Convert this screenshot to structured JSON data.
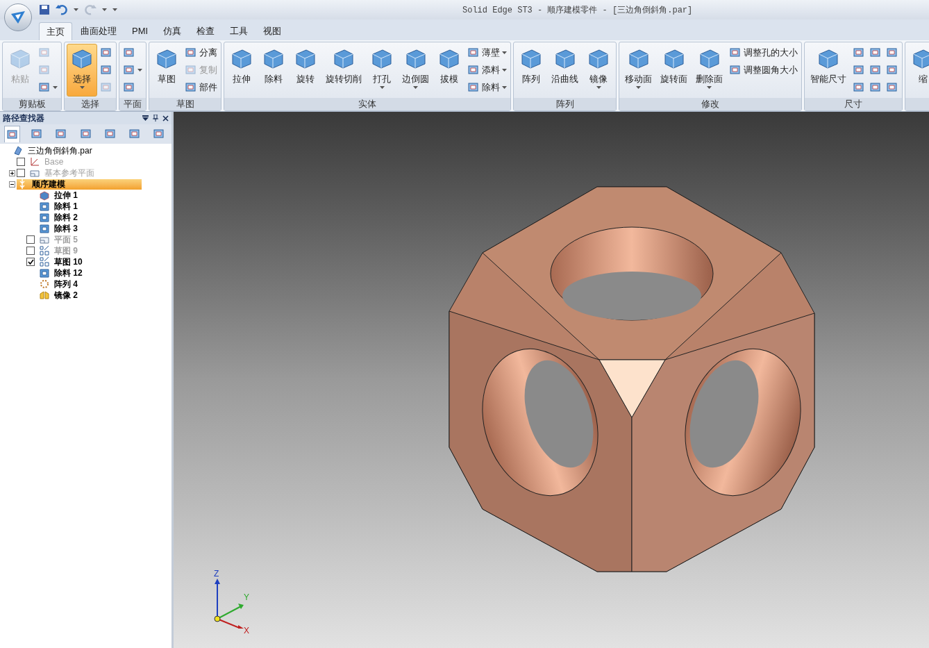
{
  "window": {
    "title": "Solid Edge ST3 - 顺序建模零件 - [三边角倒斜角.par]"
  },
  "tabs": [
    {
      "label": "主页",
      "selected": true
    },
    {
      "label": "曲面处理",
      "selected": false
    },
    {
      "label": "PMI",
      "selected": false
    },
    {
      "label": "仿真",
      "selected": false
    },
    {
      "label": "检查",
      "selected": false
    },
    {
      "label": "工具",
      "selected": false
    },
    {
      "label": "视图",
      "selected": false
    }
  ],
  "ribbon": [
    {
      "label": "剪贴板",
      "items": [
        {
          "kind": "large",
          "label": "粘贴",
          "disabled": true,
          "dropdown": false,
          "selected": false
        },
        {
          "kind": "icon",
          "disabled": true,
          "dropdown": false
        },
        {
          "kind": "icon",
          "disabled": true,
          "dropdown": false
        },
        {
          "kind": "icon",
          "disabled": false,
          "dropdown": true
        }
      ]
    },
    {
      "label": "选择",
      "items": [
        {
          "kind": "large",
          "label": "选择",
          "disabled": false,
          "dropdown": true,
          "selected": true
        },
        {
          "kind": "icon",
          "disabled": false,
          "dropdown": false
        },
        {
          "kind": "icon",
          "disabled": false,
          "dropdown": false
        },
        {
          "kind": "icon",
          "disabled": true,
          "dropdown": false
        }
      ]
    },
    {
      "label": "平面",
      "items": [
        {
          "kind": "icon",
          "disabled": false,
          "dropdown": false
        },
        {
          "kind": "icon",
          "disabled": false,
          "dropdown": true
        },
        {
          "kind": "icon",
          "disabled": false,
          "dropdown": false
        }
      ]
    },
    {
      "label": "草图",
      "items": [
        {
          "kind": "large",
          "label": "草图",
          "disabled": false,
          "dropdown": false,
          "selected": false
        },
        {
          "kind": "small",
          "label": "分离",
          "disabled": false,
          "dropdown": false
        },
        {
          "kind": "small",
          "label": "复制",
          "disabled": true,
          "dropdown": false
        },
        {
          "kind": "small",
          "label": "部件",
          "disabled": false,
          "dropdown": false
        }
      ]
    },
    {
      "label": "实体",
      "items": [
        {
          "kind": "large",
          "label": "拉伸",
          "disabled": false,
          "dropdown": false,
          "selected": false
        },
        {
          "kind": "large",
          "label": "除料",
          "disabled": false,
          "dropdown": false,
          "selected": false
        },
        {
          "kind": "large",
          "label": "旋转",
          "disabled": false,
          "dropdown": false,
          "selected": false
        },
        {
          "kind": "large",
          "label": "旋转切削",
          "disabled": false,
          "dropdown": false,
          "selected": false
        },
        {
          "kind": "large",
          "label": "打孔",
          "disabled": false,
          "dropdown": true,
          "selected": false
        },
        {
          "kind": "large",
          "label": "边倒圆",
          "disabled": false,
          "dropdown": true,
          "selected": false
        },
        {
          "kind": "large",
          "label": "拔模",
          "disabled": false,
          "dropdown": false,
          "selected": false
        },
        {
          "kind": "small",
          "label": "薄壁",
          "disabled": false,
          "dropdown": true
        },
        {
          "kind": "small",
          "label": "添料",
          "disabled": false,
          "dropdown": true
        },
        {
          "kind": "small",
          "label": "除料",
          "disabled": false,
          "dropdown": true
        }
      ]
    },
    {
      "label": "阵列",
      "items": [
        {
          "kind": "large",
          "label": "阵列",
          "disabled": false,
          "dropdown": false,
          "selected": false
        },
        {
          "kind": "large",
          "label": "沿曲线",
          "disabled": false,
          "dropdown": false,
          "selected": false
        },
        {
          "kind": "large",
          "label": "镜像",
          "disabled": false,
          "dropdown": true,
          "selected": false
        }
      ]
    },
    {
      "label": "修改",
      "items": [
        {
          "kind": "large",
          "label": "移动面",
          "disabled": false,
          "dropdown": true,
          "selected": false
        },
        {
          "kind": "large",
          "label": "旋转面",
          "disabled": false,
          "dropdown": false,
          "selected": false
        },
        {
          "kind": "large",
          "label": "删除面",
          "disabled": false,
          "dropdown": true,
          "selected": false
        },
        {
          "kind": "small",
          "label": "调整孔的大小",
          "disabled": false,
          "dropdown": false
        },
        {
          "kind": "small",
          "label": "调整圆角大小",
          "disabled": false,
          "dropdown": false
        }
      ]
    },
    {
      "label": "尺寸",
      "items": [
        {
          "kind": "large",
          "label": "智能尺寸",
          "disabled": false,
          "dropdown": false,
          "selected": false
        },
        {
          "kind": "icon",
          "disabled": false,
          "dropdown": false
        },
        {
          "kind": "icon",
          "disabled": false,
          "dropdown": false
        },
        {
          "kind": "icon",
          "disabled": false,
          "dropdown": false
        },
        {
          "kind": "icon",
          "disabled": false,
          "dropdown": false
        },
        {
          "kind": "icon",
          "disabled": false,
          "dropdown": false
        },
        {
          "kind": "icon",
          "disabled": false,
          "dropdown": false
        },
        {
          "kind": "icon",
          "disabled": false,
          "dropdown": false
        },
        {
          "kind": "icon",
          "disabled": false,
          "dropdown": false
        },
        {
          "kind": "icon",
          "disabled": false,
          "dropdown": false
        }
      ]
    },
    {
      "items": [
        {
          "kind": "large",
          "label": "缩",
          "disabled": false,
          "dropdown": false,
          "selected": false
        }
      ]
    }
  ],
  "pathfinder": {
    "title": "路径查找器",
    "view_tabs": [
      {
        "selected": true
      },
      {
        "selected": false
      },
      {
        "selected": false
      },
      {
        "selected": false
      },
      {
        "selected": false
      },
      {
        "selected": false
      },
      {
        "selected": false
      }
    ],
    "tree": [
      {
        "label": "三边角倒斜角.par",
        "kind": "part",
        "dimmed": false,
        "bold": false,
        "children": [
          {
            "label": "Base",
            "kind": "csys",
            "checked": false,
            "dimmed": true,
            "bold": false
          },
          {
            "label": "基本参考平面",
            "kind": "plane",
            "checked": false,
            "dimmed": true,
            "bold": false,
            "expanded": false
          },
          {
            "label": "顺序建模",
            "kind": "ordered",
            "dimmed": false,
            "bold": true,
            "selected": true,
            "expanded": true,
            "children": [
              {
                "label": "拉伸 1",
                "kind": "extrude",
                "dimmed": false,
                "bold": true
              },
              {
                "label": "除料 1",
                "kind": "cutout",
                "dimmed": false,
                "bold": true
              },
              {
                "label": "除料 2",
                "kind": "cutout",
                "dimmed": false,
                "bold": true
              },
              {
                "label": "除料 3",
                "kind": "cutout",
                "dimmed": false,
                "bold": true
              },
              {
                "label": "平面 5",
                "kind": "plane",
                "checked": false,
                "dimmed": true,
                "bold": true
              },
              {
                "label": "草图 9",
                "kind": "sketch",
                "checked": false,
                "dimmed": true,
                "bold": true
              },
              {
                "label": "草图 10",
                "kind": "sketch",
                "checked": true,
                "dimmed": false,
                "bold": true
              },
              {
                "label": "除料 12",
                "kind": "cutout",
                "dimmed": false,
                "bold": true
              },
              {
                "label": "阵列 4",
                "kind": "pattern",
                "dimmed": false,
                "bold": true
              },
              {
                "label": "镜像 2",
                "kind": "mirror",
                "dimmed": false,
                "bold": true
              }
            ]
          }
        ]
      }
    ]
  },
  "triad": {
    "z": "Z",
    "y": "Y",
    "x": "X"
  }
}
